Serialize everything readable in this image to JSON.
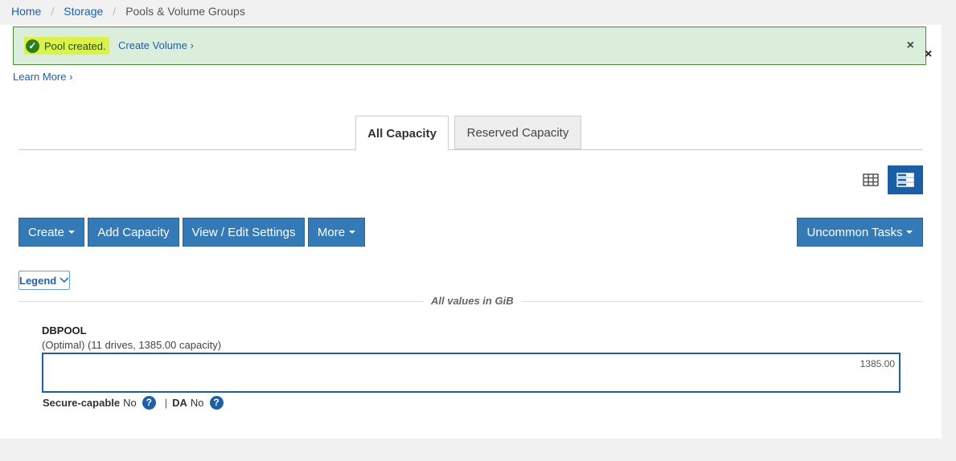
{
  "breadcrumb": {
    "home": "Home",
    "storage": "Storage",
    "current": "Pools & Volume Groups",
    "separator": "/"
  },
  "alert": {
    "message": "Pool created.",
    "link": "Create Volume ›",
    "close": "×",
    "stray": "×"
  },
  "learn_more": "Learn More ›",
  "tabs": [
    {
      "label": "All Capacity",
      "active": true
    },
    {
      "label": "Reserved Capacity",
      "active": false
    }
  ],
  "view_toggle": {
    "grid_icon": "table-icon",
    "list_icon": "list-view-icon",
    "active": "list"
  },
  "toolbar": {
    "create": "Create",
    "add_capacity": "Add Capacity",
    "view_edit": "View / Edit Settings",
    "more": "More",
    "uncommon": "Uncommon Tasks"
  },
  "legend": {
    "label": "Legend"
  },
  "units": "All values in GiB",
  "pool": {
    "name": "DBPOOL",
    "status": "(Optimal) (11 drives, 1385.00 capacity)",
    "capacity_value": "1385.00",
    "secure_label": "Secure-capable",
    "secure_value": "No",
    "da_label": "DA",
    "da_value": "No",
    "help_glyph": "?"
  },
  "colors": {
    "primary": "#337ab7",
    "alert_bg": "#dbeedb",
    "alert_highlight": "#dbf24a",
    "link": "#1f5fa6"
  }
}
